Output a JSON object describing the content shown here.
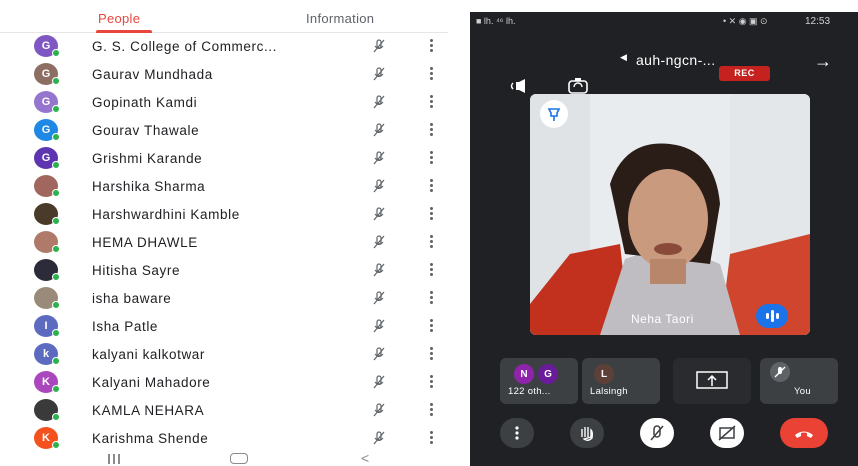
{
  "tabs": {
    "people": "People",
    "information": "Information"
  },
  "participants": [
    {
      "name": "G. S. College of Commerc...",
      "initial": "G",
      "color": "#7e57c2"
    },
    {
      "name": "Gaurav Mundhada",
      "initial": "G",
      "color": "#8d6e63"
    },
    {
      "name": "Gopinath Kamdi",
      "initial": "G",
      "color": "#9575cd"
    },
    {
      "name": "Gourav Thawale",
      "initial": "G",
      "color": "#1e88e5"
    },
    {
      "name": "Grishmi Karande",
      "initial": "G",
      "color": "#5e35b1"
    },
    {
      "name": "Harshika Sharma",
      "initial": "",
      "color": "#a1665e"
    },
    {
      "name": "Harshwardhini Kamble",
      "initial": "",
      "color": "#4a3a2a"
    },
    {
      "name": "HEMA DHAWLE",
      "initial": "",
      "color": "#b07a6a"
    },
    {
      "name": "Hitisha Sayre",
      "initial": "",
      "color": "#2b2b3a"
    },
    {
      "name": "isha baware",
      "initial": "",
      "color": "#9a8a7a"
    },
    {
      "name": "Isha Patle",
      "initial": "I",
      "color": "#5c6bc0"
    },
    {
      "name": "kalyani kalkotwar",
      "initial": "k",
      "color": "#5c6bc0"
    },
    {
      "name": "Kalyani Mahadore",
      "initial": "K",
      "color": "#ab47bc"
    },
    {
      "name": "KAMLA NEHARA",
      "initial": "",
      "color": "#3a3a3a"
    },
    {
      "name": "Karishma Shende",
      "initial": "K",
      "color": "#f4511e"
    }
  ],
  "status_bar": {
    "time": "12:53",
    "left": "■ lh. ⁴⁶ lh.",
    "mid": "• ✕ ◉ ▣ ⊙"
  },
  "meeting": {
    "name": "auh-ngcn-...",
    "rec_label": "REC",
    "speaker_name": "Neha Taori",
    "tiles": [
      {
        "label": "You"
      },
      {
        "label": ""
      },
      {
        "label": "Lalsingh",
        "initial": "L"
      },
      {
        "label": "122 oth...",
        "initials": [
          "G",
          "N"
        ]
      }
    ]
  }
}
